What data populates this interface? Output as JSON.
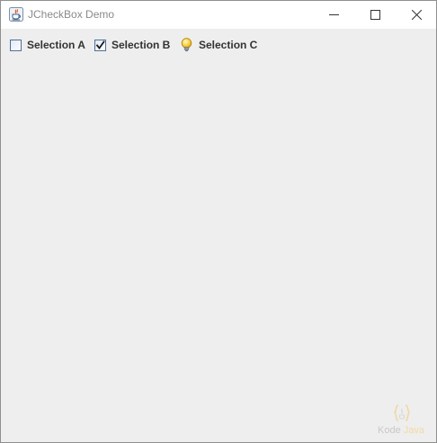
{
  "window": {
    "title": "JCheckBox Demo",
    "controls": {
      "minimize": "minimize-icon",
      "maximize": "maximize-icon",
      "close": "close-icon"
    }
  },
  "checkboxes": [
    {
      "label": "Selection A",
      "checked": false,
      "icon": "checkbox-unchecked-icon"
    },
    {
      "label": "Selection B",
      "checked": true,
      "icon": "checkbox-checked-icon"
    },
    {
      "label": "Selection C",
      "icon": "lightbulb-icon"
    }
  ],
  "watermark": {
    "part1": "Kode",
    "part2": "Java",
    "colors": {
      "kode": "#c8c8c8",
      "java": "#f3d9a6"
    }
  },
  "colors": {
    "content_bg": "#eeeeee",
    "titlebar_bg": "#ffffff",
    "title_text": "#8a8a8a",
    "label_text": "#333333",
    "checkbox_border": "#4f6f95"
  }
}
